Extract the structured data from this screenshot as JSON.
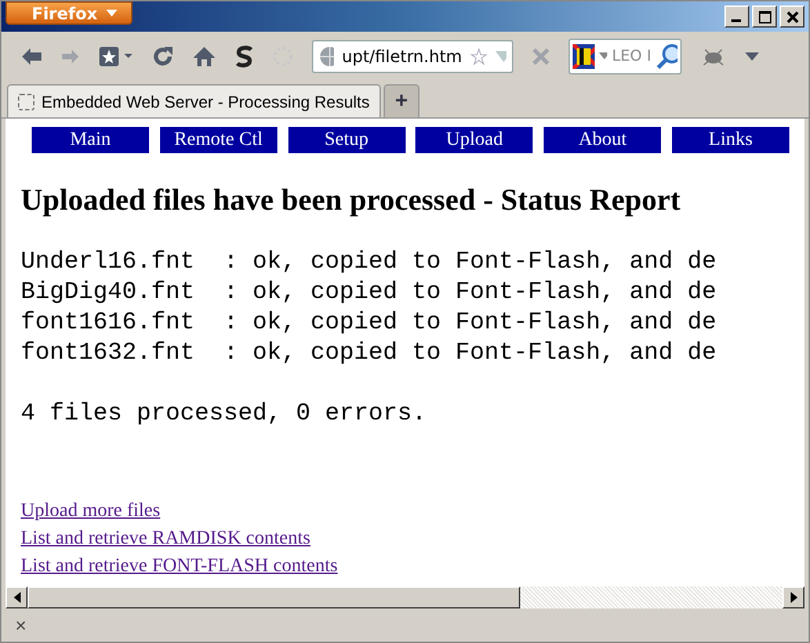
{
  "window": {
    "app_menu": "Firefox"
  },
  "toolbar": {
    "address": "upt/filetrn.htm",
    "search": "LEO I"
  },
  "tabs": [
    {
      "label": "Embedded Web Server - Processing Results",
      "selected": true
    }
  ],
  "new_tab_button": "+",
  "page": {
    "nav": [
      "Main",
      "Remote Ctl",
      "Setup",
      "Upload",
      "About",
      "Links"
    ],
    "heading": "Uploaded files have been processed - Status Report",
    "results": [
      "Underl16.fnt  : ok, copied to Font-Flash, and de",
      "BigDig40.fnt  : ok, copied to Font-Flash, and de",
      "font1616.fnt  : ok, copied to Font-Flash, and de",
      "font1632.fnt  : ok, copied to Font-Flash, and de"
    ],
    "summary": "4 files processed, 0 errors.",
    "links": [
      "Upload more files",
      "List and retrieve RAMDISK contents",
      "List and retrieve FONT-FLASH contents"
    ]
  },
  "status_bar": {
    "close": "×"
  }
}
